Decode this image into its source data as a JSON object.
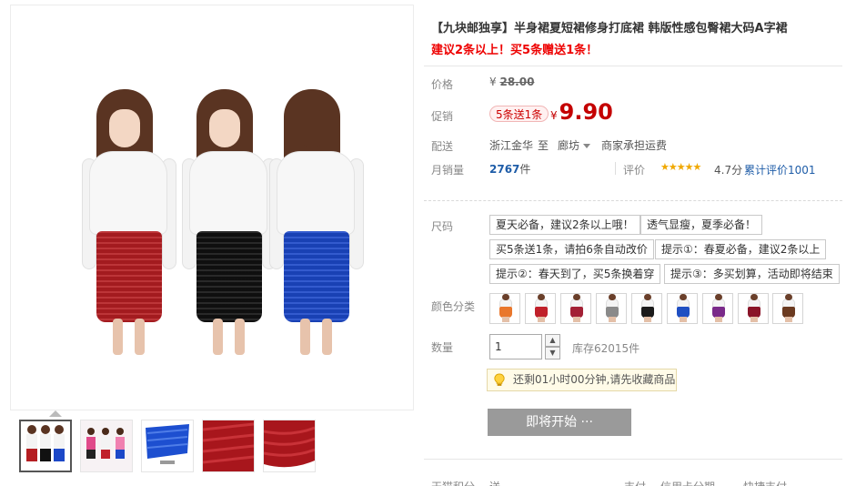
{
  "product": {
    "title": "【九块邮独享】半身裙夏短裙修身打底裙 韩版性感包臀裙大码A字裙",
    "subtitle": "建议2条以上！买5条赠送1条！"
  },
  "price": {
    "label": "价格",
    "currency": "¥",
    "original": "28.00"
  },
  "promotion": {
    "label": "促销",
    "tag": "5条送1条",
    "currency": "¥",
    "price": "9.90"
  },
  "shipping": {
    "label": "配送",
    "from": "浙江金华",
    "to_word": "至",
    "destination": "廊坊",
    "note": "商家承担运费"
  },
  "sales": {
    "label": "月销量",
    "count": "2767",
    "unit": "件",
    "rating_label": "评价",
    "stars": "★★★★★",
    "score": "4.7分",
    "total_reviews": "累计评价1001"
  },
  "size": {
    "label": "尺码",
    "options": [
      "夏天必备，建议2条以上哦！",
      "透气显瘦，夏季必备！",
      "买5条送1条，请拍6条自动改价",
      "提示①：春夏必备，建议2条以上",
      "提示②：春天到了，买5条换着穿",
      "提示③：多买划算，活动即将结束"
    ]
  },
  "color": {
    "label": "颜色分类",
    "swatches": [
      "orange-skirt",
      "red-skirt",
      "burgundy-skirt",
      "gray-skirt",
      "black-skirt",
      "blue-skirt",
      "purple-skirt",
      "wine-skirt",
      "brown-skirt"
    ],
    "swatch_colors": [
      "#e9772c",
      "#c0202a",
      "#a32035",
      "#8a8a8a",
      "#1b1b1b",
      "#1f4fc2",
      "#7a2a8a",
      "#8a1428",
      "#6b3a20"
    ]
  },
  "quantity": {
    "label": "数量",
    "value": "1",
    "stock": "库存62015件"
  },
  "tip": {
    "text": "还剩01小时00分钟,请先收藏商品"
  },
  "button": {
    "start_label": "即将开始 ···"
  },
  "footer_peek": [
    "天猫积分",
    "送",
    "支付",
    "信用卡分期",
    "快捷支付"
  ],
  "gallery": {
    "model_skirt_colors": [
      "#b51e22",
      "#111111",
      "#1c48c8"
    ]
  }
}
